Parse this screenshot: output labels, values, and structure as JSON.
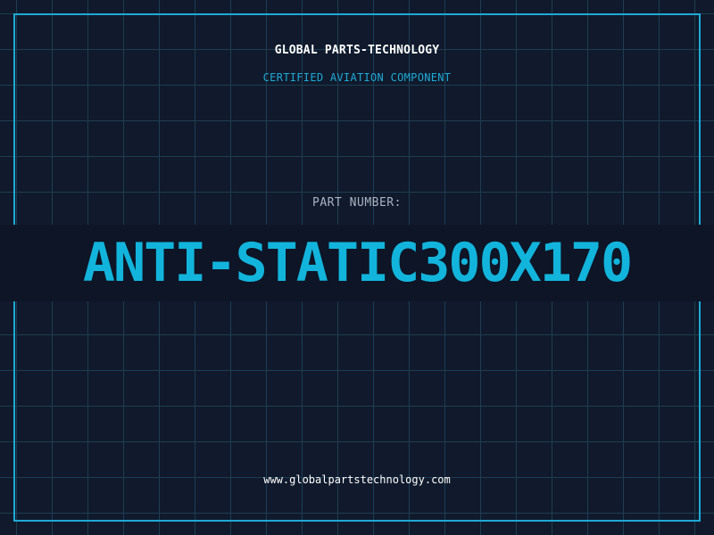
{
  "header": {
    "brand": "GLOBAL PARTS-TECHNOLOGY",
    "tagline": "CERTIFIED AVIATION COMPONENT"
  },
  "part": {
    "label": "PART NUMBER:",
    "number": "ANTI-STATIC300X170"
  },
  "footer": {
    "website": "www.globalpartstechnology.com"
  },
  "colors": {
    "background": "#101a2c",
    "grid": "#1e3d52",
    "accent": "#1fa9d6",
    "part_number": "#12b4dc",
    "band": "#0d1526"
  }
}
